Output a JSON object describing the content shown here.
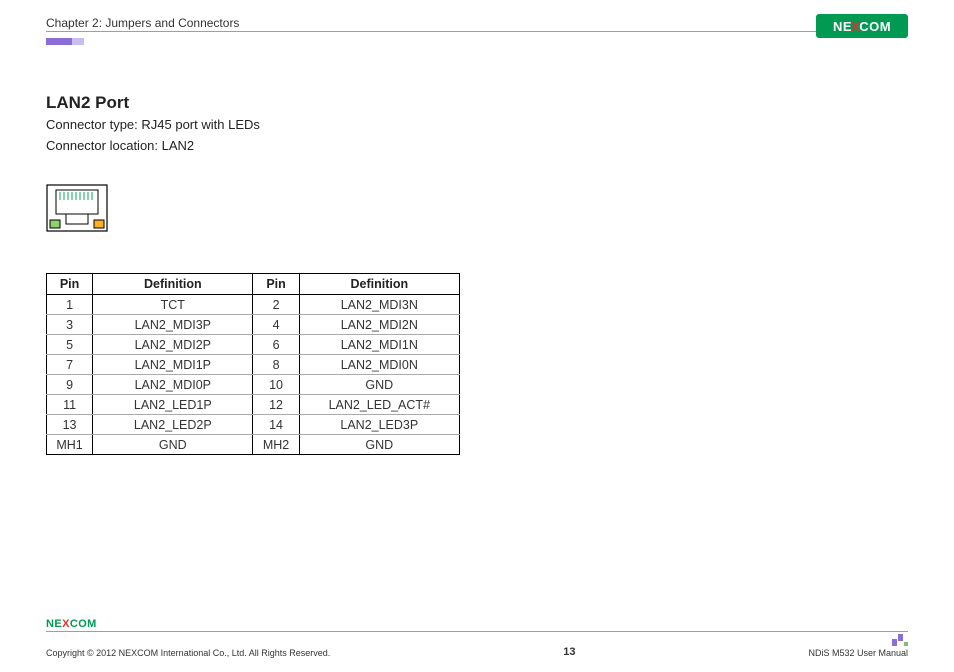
{
  "header": {
    "chapter": "Chapter 2: Jumpers and Connectors",
    "logo_text_left": "NE",
    "logo_text_x": "X",
    "logo_text_right": "COM"
  },
  "section": {
    "title": "LAN2 Port",
    "connector_type": "Connector type: RJ45 port with LEDs",
    "connector_location": "Connector location: LAN2"
  },
  "table": {
    "headers": {
      "pin": "Pin",
      "def": "Definition"
    },
    "rows": [
      {
        "p1": "1",
        "d1": "TCT",
        "p2": "2",
        "d2": "LAN2_MDI3N"
      },
      {
        "p1": "3",
        "d1": "LAN2_MDI3P",
        "p2": "4",
        "d2": "LAN2_MDI2N"
      },
      {
        "p1": "5",
        "d1": "LAN2_MDI2P",
        "p2": "6",
        "d2": "LAN2_MDI1N"
      },
      {
        "p1": "7",
        "d1": "LAN2_MDI1P",
        "p2": "8",
        "d2": "LAN2_MDI0N"
      },
      {
        "p1": "9",
        "d1": "LAN2_MDI0P",
        "p2": "10",
        "d2": "GND"
      },
      {
        "p1": "11",
        "d1": "LAN2_LED1P",
        "p2": "12",
        "d2": "LAN2_LED_ACT#"
      },
      {
        "p1": "13",
        "d1": "LAN2_LED2P",
        "p2": "14",
        "d2": "LAN2_LED3P"
      },
      {
        "p1": "MH1",
        "d1": "GND",
        "p2": "MH2",
        "d2": "GND"
      }
    ]
  },
  "footer": {
    "logo_left": "NE",
    "logo_x": "X",
    "logo_right": "COM",
    "copyright": "Copyright © 2012 NEXCOM International Co., Ltd. All Rights Reserved.",
    "page_number": "13",
    "manual_name": "NDiS M532 User Manual"
  }
}
